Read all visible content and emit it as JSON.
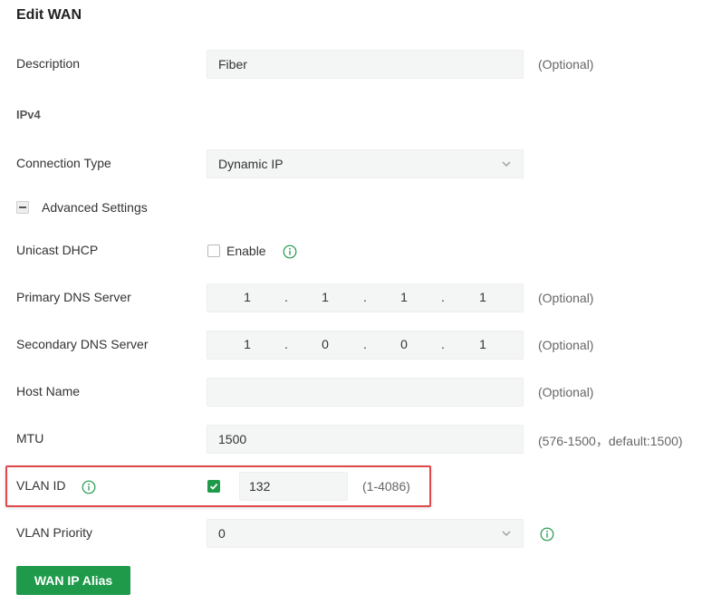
{
  "page": {
    "title": "Edit WAN"
  },
  "colors": {
    "accent": "#1e9a4a",
    "highlight_border": "#e0484c",
    "field_bg": "#f4f5f5"
  },
  "description": {
    "label": "Description",
    "value": "Fiber",
    "hint": "(Optional)"
  },
  "ipv4": {
    "section_label": "IPv4"
  },
  "connection_type": {
    "label": "Connection Type",
    "value": "Dynamic IP"
  },
  "advanced": {
    "label": "Advanced Settings"
  },
  "unicast_dhcp": {
    "label": "Unicast DHCP",
    "checkbox_label": "Enable",
    "checked": false
  },
  "primary_dns": {
    "label": "Primary DNS Server",
    "octets": [
      "1",
      "1",
      "1",
      "1"
    ],
    "hint": "(Optional)"
  },
  "secondary_dns": {
    "label": "Secondary DNS Server",
    "octets": [
      "1",
      "0",
      "0",
      "1"
    ],
    "hint": "(Optional)"
  },
  "host_name": {
    "label": "Host Name",
    "value": "",
    "hint": "(Optional)"
  },
  "mtu": {
    "label": "MTU",
    "value": "1500",
    "hint": "(576-1500，default:1500)"
  },
  "vlan_id": {
    "label": "VLAN ID",
    "checked": true,
    "value": "132",
    "hint": "(1-4086)"
  },
  "vlan_priority": {
    "label": "VLAN Priority",
    "value": "0"
  },
  "buttons": {
    "wan_ip_alias": "WAN IP Alias"
  },
  "icons": {
    "info": "info-icon",
    "chevron": "chevron-down-icon",
    "check": "checkmark-icon",
    "collapse": "minus-icon"
  }
}
